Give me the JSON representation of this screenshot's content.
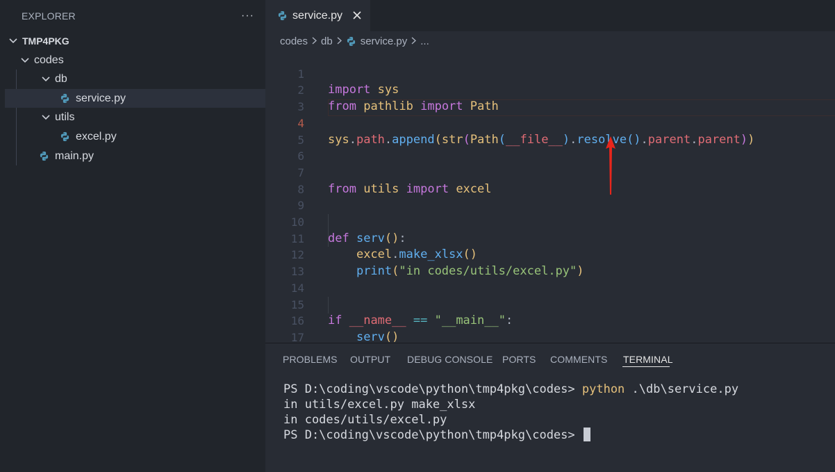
{
  "explorer": {
    "title": "EXPLORER",
    "more_icon": "ellipsis-icon",
    "root_folder": "TMP4PKG",
    "items": [
      {
        "label": "codes",
        "type": "folder"
      },
      {
        "label": "db",
        "type": "folder"
      },
      {
        "label": "service.py",
        "type": "python-file",
        "selected": true
      },
      {
        "label": "utils",
        "type": "folder"
      },
      {
        "label": "excel.py",
        "type": "python-file"
      },
      {
        "label": "main.py",
        "type": "python-file"
      }
    ]
  },
  "editor": {
    "tab_label": "service.py",
    "breadcrumb": [
      "codes",
      "db",
      "service.py",
      "..."
    ],
    "active_line": 4,
    "line_numbers": [
      "1",
      "2",
      "3",
      "4",
      "5",
      "6",
      "7",
      "8",
      "9",
      "10",
      "11",
      "12",
      "13",
      "14",
      "15",
      "16",
      "17"
    ]
  },
  "panel": {
    "tabs": [
      "PROBLEMS",
      "OUTPUT",
      "DEBUG CONSOLE",
      "PORTS",
      "COMMENTS",
      "TERMINAL"
    ],
    "active_tab": "TERMINAL",
    "terminal": {
      "prompt": "PS D:\\coding\\vscode\\python\\tmp4pkg\\codes> ",
      "command": "python",
      "command_args": " .\\db\\service.py",
      "output": [
        "in utils/excel.py make_xlsx",
        "in codes/utils/excel.py"
      ],
      "final_prompt": "PS D:\\coding\\vscode\\python\\tmp4pkg\\codes> "
    }
  },
  "colors": {
    "keyword": "#c678dd",
    "module": "#e5c07b",
    "function": "#61afef",
    "variable": "#e06c75",
    "string": "#98c379",
    "annotation_arrow": "#e8261c"
  }
}
